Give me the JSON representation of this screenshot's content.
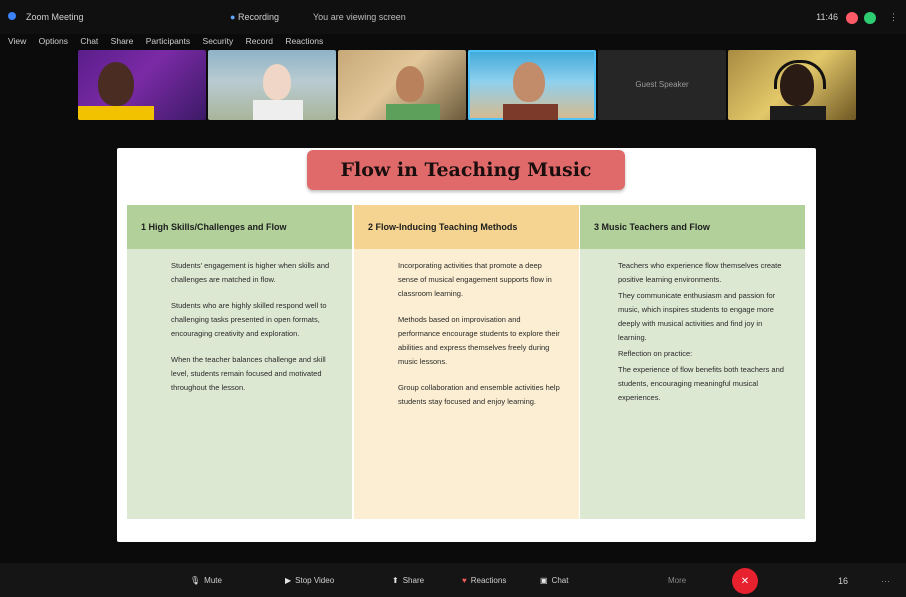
{
  "window": {
    "title": "Zoom Meeting",
    "meeting_label": "Recording",
    "meta": "You are viewing screen",
    "time": "11:46",
    "more": "⋮"
  },
  "menubar": {
    "items": [
      "View",
      "Options",
      "Chat",
      "Share",
      "Participants",
      "Security",
      "Record",
      "Reactions"
    ]
  },
  "participants": [
    {
      "name": ""
    },
    {
      "name": ""
    },
    {
      "name": ""
    },
    {
      "name": ""
    },
    {
      "name": "Guest Speaker"
    },
    {
      "name": ""
    }
  ],
  "slide": {
    "title": "Flow in Teaching Music",
    "columns": [
      {
        "heading": "1 High Skills/Challenges and Flow",
        "paragraphs": [
          "Students' engagement is higher when skills and challenges are matched in flow.",
          "Students who are highly skilled respond well to challenging tasks presented in open formats, encouraging creativity and exploration.",
          "When the teacher balances challenge and skill level, students remain focused and motivated throughout the lesson."
        ]
      },
      {
        "heading": "2 Flow-Inducing Teaching Methods",
        "paragraphs": [
          "Incorporating activities that promote a deep sense of musical engagement supports flow in classroom learning.",
          "Methods based on improvisation and performance encourage students to explore their abilities and express themselves freely during music lessons.",
          "Group collaboration and ensemble activities help students stay focused and enjoy learning."
        ]
      },
      {
        "heading": "3 Music Teachers and Flow",
        "paragraphs": [
          "Teachers who experience flow themselves create positive learning environments.",
          "They communicate enthusiasm and passion for music, which inspires students to engage more deeply with musical activities and find joy in learning.",
          "Reflection on practice:",
          "The experience of flow benefits both teachers and students, encouraging meaningful musical experiences."
        ]
      }
    ]
  },
  "controls": {
    "mic": "Mute",
    "camera": "Stop Video",
    "share": "Share",
    "react": "Reactions",
    "chat": "Chat",
    "more": "More",
    "leave_icon": "✕",
    "people": "16",
    "menu": "⋯"
  },
  "colors": {
    "title_box": "#e06a6a",
    "green_header": "#b1d09a",
    "green_body": "#dde8d3",
    "yellow_header": "#f5d491",
    "yellow_body": "#fbeed2",
    "leave": "#e8212e",
    "active_speaker": "#4fc3f7"
  }
}
